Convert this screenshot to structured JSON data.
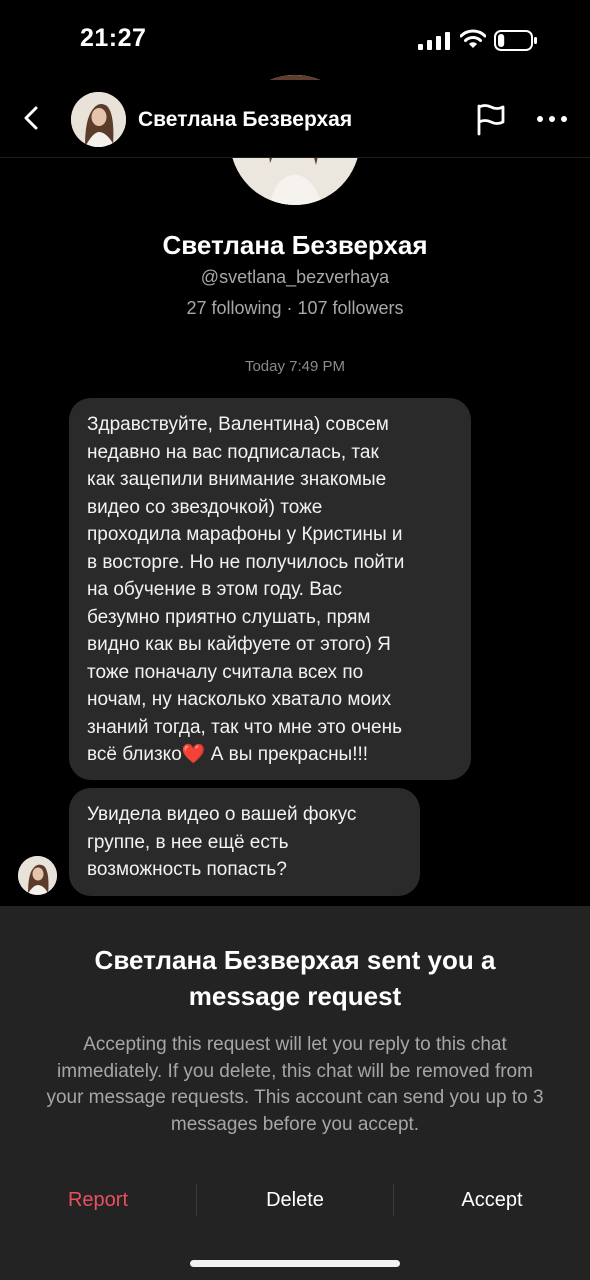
{
  "status": {
    "time": "21:27",
    "icons": [
      "cellular-signal-icon",
      "wifi-icon",
      "battery-icon"
    ],
    "battery_level": 0.2
  },
  "header": {
    "name": "Светлана Безверхая",
    "icons": [
      "back-chevron-icon",
      "flag-icon",
      "more-icon"
    ]
  },
  "profile": {
    "name": "Светлана Безверхая",
    "handle": "@svetlana_bezverhaya",
    "stats": "27 following · 107 followers"
  },
  "chat": {
    "timestamp": "Today 7:49 PM",
    "messages": [
      {
        "text": "Здравствуйте, Валентина) совсем\nнедавно на вас подписалась, так\nкак зацепили внимание знакомые\nвидео со звездочкой) тоже\nпроходила марафоны у Кристины и\nв восторге. Но не получилось пойти\nна обучение в этом году. Вас\nбезумно приятно слушать, прям\nвидно как вы кайфуете от этого) Я\nтоже поначалу считала всех по\nночам, ну насколько хватало моих\nзнаний тогда, так что мне это очень\nвсё близко",
        "emoji": "❤️",
        "text_after": "  А вы прекрасны!!!"
      },
      {
        "text": "Увидела видео о вашей фокус\nгруппе, в нее ещё есть\nвозможность попасть?"
      }
    ]
  },
  "sheet": {
    "title": "Светлана Безверхая sent you a message request",
    "body": "Accepting this request will let you reply to this chat immediately. If you delete, this chat will be removed from your message requests. This account can send you up to 3 messages before you accept.",
    "actions": {
      "report": "Report",
      "delete": "Delete",
      "accept": "Accept"
    },
    "report_color": "#E8505B"
  }
}
